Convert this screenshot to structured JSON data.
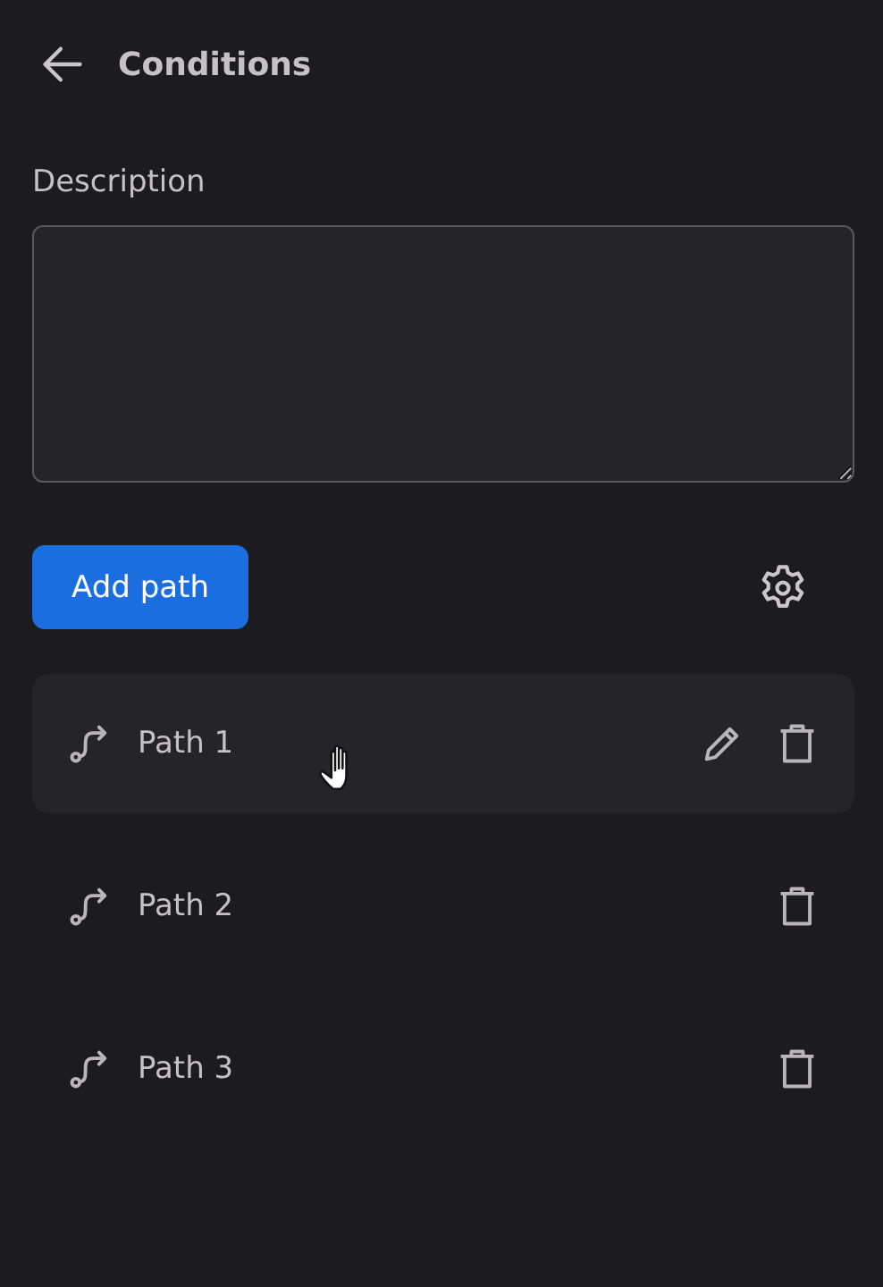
{
  "header": {
    "title": "Conditions"
  },
  "description": {
    "label": "Description"
  },
  "toolbar": {
    "add_button": "Add path"
  },
  "paths": [
    {
      "label": "Path 1",
      "hovered": true
    },
    {
      "label": "Path 2",
      "hovered": false
    },
    {
      "label": "Path 3",
      "hovered": false
    }
  ]
}
